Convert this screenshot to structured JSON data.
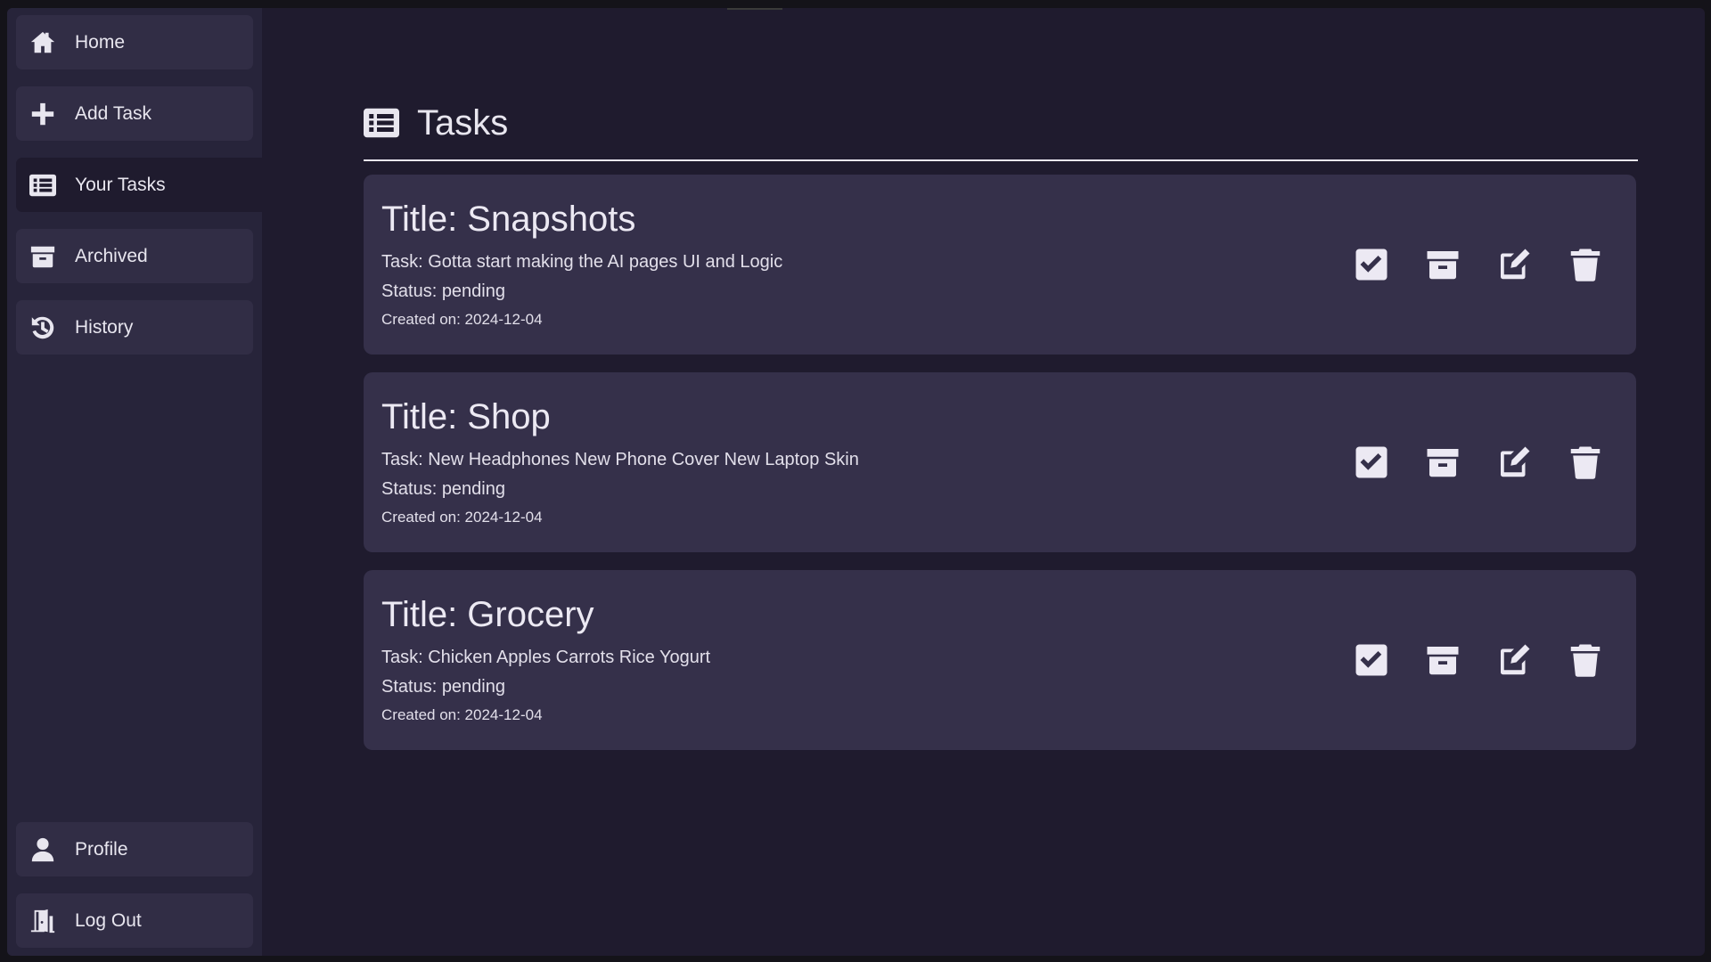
{
  "sidebar": {
    "items": [
      {
        "label": "Home",
        "icon": "home-icon"
      },
      {
        "label": "Add Task",
        "icon": "plus-icon"
      },
      {
        "label": "Your Tasks",
        "icon": "list-icon"
      },
      {
        "label": "Archived",
        "icon": "archive-icon"
      },
      {
        "label": "History",
        "icon": "history-icon"
      }
    ],
    "bottom": [
      {
        "label": "Profile",
        "icon": "user-icon"
      },
      {
        "label": "Log Out",
        "icon": "door-exit-icon"
      }
    ]
  },
  "header": {
    "title": "Tasks",
    "icon": "list-icon"
  },
  "tasks": [
    {
      "title": "Title: Snapshots",
      "task": "Task: Gotta start making the AI pages UI and Logic",
      "status": "Status: pending",
      "created": "Created on: 2024-12-04"
    },
    {
      "title": "Title: Shop",
      "task": "Task: New Headphones New Phone Cover New Laptop Skin",
      "status": "Status: pending",
      "created": "Created on: 2024-12-04"
    },
    {
      "title": "Title: Grocery",
      "task": "Task: Chicken Apples Carrots Rice Yogurt",
      "status": "Status: pending",
      "created": "Created on: 2024-12-04"
    }
  ],
  "task_actions": [
    "checkbox-complete-icon",
    "archive-icon",
    "edit-icon",
    "trash-icon"
  ],
  "colors": {
    "background": "#1f1b2e",
    "sidebar": "#27243a",
    "nav_item": "#312d45",
    "card": "#35304a",
    "text": "#e8e6ef"
  }
}
